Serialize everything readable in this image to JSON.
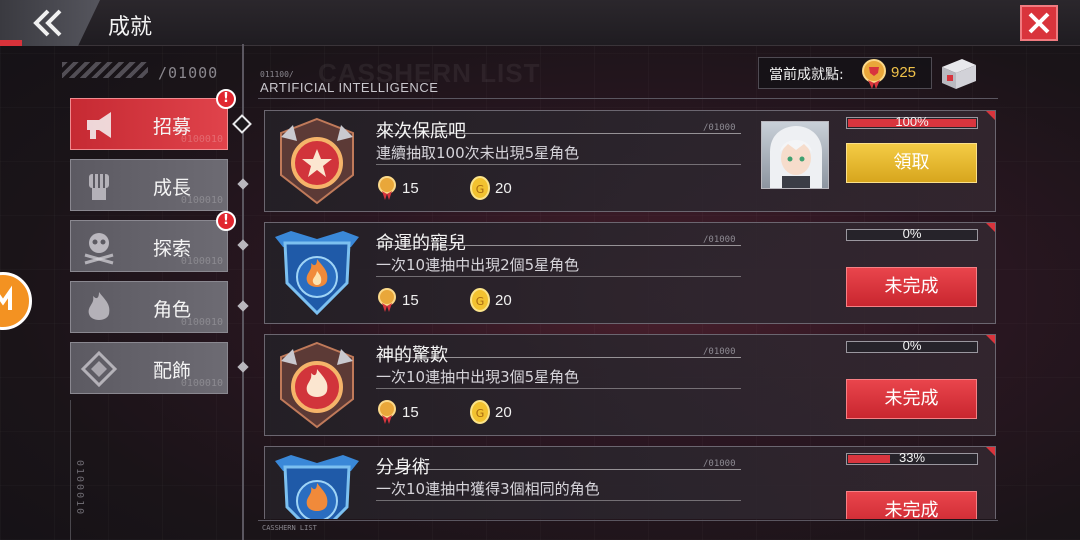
{
  "header": {
    "title": "成就",
    "back_icon": "double-chevron-left-icon",
    "close_icon": "close-x-icon"
  },
  "left_panel": {
    "code": "/01000",
    "vertical_code": "0100010",
    "categories": [
      {
        "label": "招募",
        "icon": "megaphone-icon",
        "active": true,
        "alert": "!",
        "code": "0100010"
      },
      {
        "label": "成長",
        "icon": "fist-icon",
        "active": false,
        "alert": "",
        "code": "0100010"
      },
      {
        "label": "探索",
        "icon": "skull-crossbones-icon",
        "active": false,
        "alert": "!",
        "code": "0100010"
      },
      {
        "label": "角色",
        "icon": "flame-icon",
        "active": false,
        "alert": "",
        "code": "0100010"
      },
      {
        "label": "配飾",
        "icon": "diamond-emblem-icon",
        "active": false,
        "alert": "",
        "code": "0100010"
      }
    ]
  },
  "list": {
    "code": "011100/",
    "header": "ARTIFICIAL INTELLIGENCE",
    "watermark": "CASSHERN LIST",
    "footer_code": "CASSHERN LIST",
    "points_label": "當前成就點:",
    "points_value": "925"
  },
  "achievements": [
    {
      "title": "來次保底吧",
      "desc": "連續抽取100次未出現5星角色",
      "code": "/01000",
      "medal_reward": "15",
      "coin_reward": "20",
      "progress": 100,
      "progress_text": "100%",
      "status": "領取",
      "status_type": "claim",
      "badge": "red-star-badge-icon",
      "has_thumb": true
    },
    {
      "title": "命運的寵兒",
      "desc": "一次10連抽中出現2個5星角色",
      "code": "/01000",
      "medal_reward": "15",
      "coin_reward": "20",
      "progress": 0,
      "progress_text": "0%",
      "status": "未完成",
      "status_type": "incomplete",
      "badge": "blue-flame-shield-badge-icon",
      "has_thumb": false
    },
    {
      "title": "神的驚歎",
      "desc": "一次10連抽中出現3個5星角色",
      "code": "/01000",
      "medal_reward": "15",
      "coin_reward": "20",
      "progress": 0,
      "progress_text": "0%",
      "status": "未完成",
      "status_type": "incomplete",
      "badge": "red-flame-badge-icon",
      "has_thumb": false
    },
    {
      "title": "分身術",
      "desc": "一次10連抽中獲得3個相同的角色",
      "code": "/01000",
      "medal_reward": "",
      "coin_reward": "",
      "progress": 33,
      "progress_text": "33%",
      "status": "未完成",
      "status_type": "incomplete",
      "badge": "blue-flame-shield-badge-icon",
      "has_thumb": false
    }
  ],
  "colors": {
    "accent_red": "#d9343c",
    "claim_gold": "#e6b82f",
    "points_gold": "#f0c24a"
  }
}
